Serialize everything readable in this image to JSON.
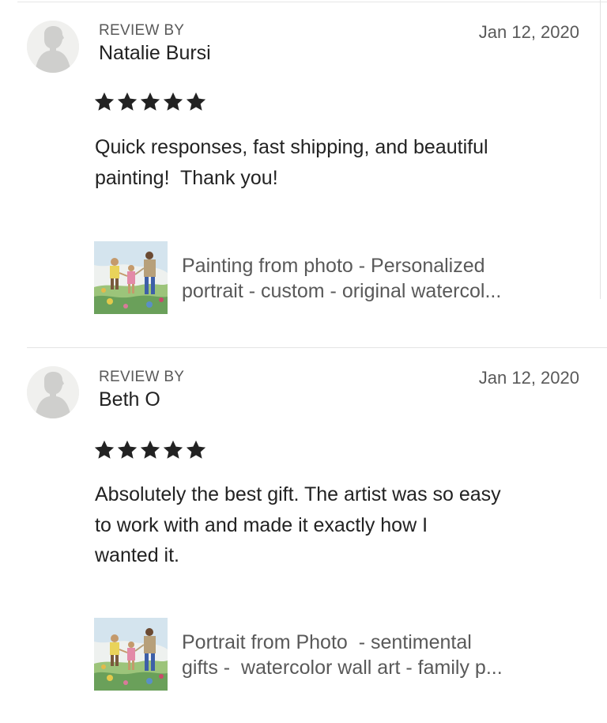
{
  "reviews": [
    {
      "review_by_label": "REVIEW BY",
      "reviewer": "Natalie Bursi",
      "date": "Jan 12, 2020",
      "rating": 5,
      "text": "Quick responses, fast shipping, and beautiful\npainting!  Thank you!",
      "listing_title": "Painting from photo - Personalized\nportrait - custom - original watercol..."
    },
    {
      "review_by_label": "REVIEW BY",
      "reviewer": "Beth O",
      "date": "Jan 12, 2020",
      "rating": 5,
      "text": "Absolutely the best gift. The artist was so easy\nto work with and made it exactly how I\nwanted it.",
      "listing_title": "Portrait from Photo  - sentimental\ngifts -  watercolor wall art - family p..."
    }
  ],
  "icons": {
    "avatar": "person-silhouette-icon",
    "star": "star-icon"
  },
  "colors": {
    "star": "#222222",
    "avatar_bg": "#f0f0ee",
    "avatar_figure": "#cfcfcd",
    "secondary_text": "#595959"
  }
}
